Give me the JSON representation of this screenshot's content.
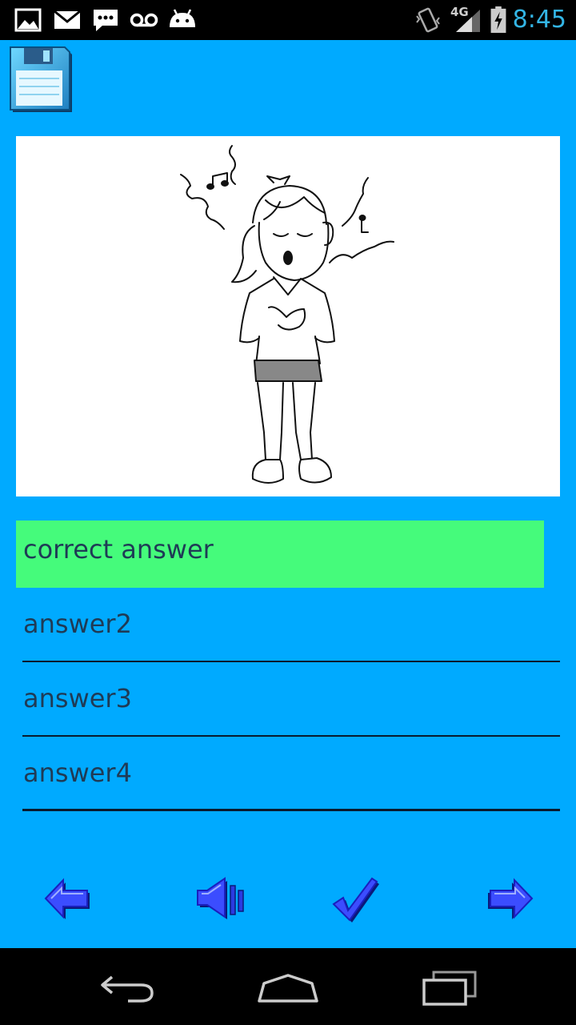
{
  "status_bar": {
    "time": "8:45",
    "network": "4G",
    "icons": [
      "image-icon",
      "mail-icon",
      "chat-icon",
      "voicemail-icon",
      "android-icon",
      "vibrate-icon",
      "signal-icon",
      "battery-charging-icon"
    ]
  },
  "toolbar_top": {
    "save_icon": "floppy-disk-icon"
  },
  "question": {
    "image": "girl-singing-illustration"
  },
  "answers": [
    {
      "label": "correct answer",
      "state": "correct"
    },
    {
      "label": "answer2",
      "state": "normal"
    },
    {
      "label": "answer3",
      "state": "normal"
    },
    {
      "label": "answer4",
      "state": "normal"
    }
  ],
  "actions": {
    "prev_icon": "arrow-left-icon",
    "sound_icon": "speaker-icon",
    "check_icon": "checkmark-icon",
    "next_icon": "arrow-right-icon"
  },
  "colors": {
    "app_background": "#00aaff",
    "correct_highlight": "#45fb7b",
    "clock": "#33b5e5",
    "icon_blue": "#1a2bff"
  },
  "nav_bar": {
    "buttons": [
      "back-icon",
      "home-icon",
      "recent-apps-icon"
    ]
  }
}
